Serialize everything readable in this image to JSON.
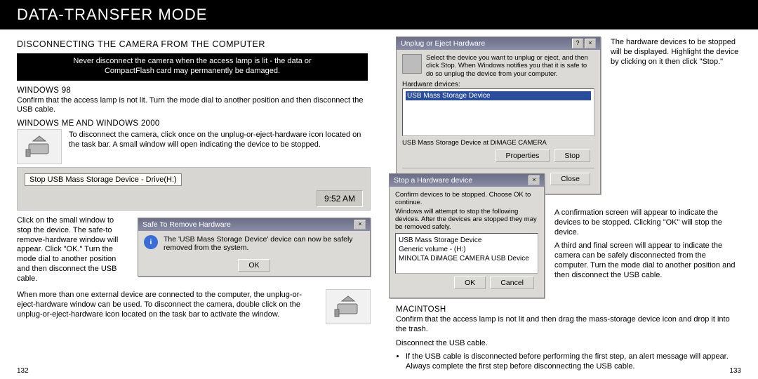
{
  "header": {
    "title": "DATA-TRANSFER MODE"
  },
  "left": {
    "subheading": "DISCONNECTING THE CAMERA FROM THE COMPUTER",
    "warning_line1": "Never disconnect the camera when the access lamp is lit - the data or",
    "warning_line2": "CompactFlash card may permanently be damaged.",
    "win98_heading": "WINDOWS 98",
    "win98_text": "Confirm that the access lamp is not lit. Turn the mode dial to another position and then disconnect the USB cable.",
    "winme_heading": "WINDOWS ME AND WINDOWS 2000",
    "winme_text": "To disconnect the camera, click once on the unplug-or-eject-hardware icon located on the task bar. A small window will open indicating the device to be stopped.",
    "taskbar_tooltip": "Stop USB Mass Storage Device - Drive(H:)",
    "taskbar_clock": "9:52 AM",
    "side_note": "Click on the small window to stop the device. The safe-to remove-hardware window will appear. Click \"OK.\" Turn the mode dial to another position and then disconnect the USB cable.",
    "safe_remove_title": "Safe To Remove Hardware",
    "safe_remove_body": "The 'USB Mass Storage Device' device can now be safely removed from the system.",
    "ok_label": "OK",
    "multi_device_text": "When more than one external device are connected to the computer, the unplug-or-eject-hardware window can be used. To disconnect the camera, double click on the unplug-or-eject-hardware icon located on the task bar to activate the window.",
    "page_num": "132"
  },
  "right": {
    "unplug_title": "Unplug or Eject Hardware",
    "unplug_instr": "Select the device you want to unplug or eject, and then click Stop. When Windows notifies you that it is safe to do so unplug the device from your computer.",
    "hw_label": "Hardware devices:",
    "hw_item": "USB Mass Storage Device",
    "device_line": "USB Mass Storage Device at DiMAGE CAMERA",
    "btn_properties": "Properties",
    "btn_stop": "Stop",
    "btn_close": "Close",
    "hw_caption": "The hardware devices to be stopped will be displayed. Highlight the device by clicking on it then click \"Stop.\"",
    "stop_title": "Stop a Hardware device",
    "stop_line1": "Confirm devices to be stopped. Choose OK to continue.",
    "stop_line2": "Windows will attempt to stop the following devices. After the devices are stopped they may be removed safely.",
    "stop_item1": "USB Mass Storage Device",
    "stop_item2": "Generic volume - (H:)",
    "stop_item3": "MINOLTA DiMAGE CAMERA USB Device",
    "btn_ok": "OK",
    "btn_cancel": "Cancel",
    "confirm_text": "A confirmation screen will appear to indicate the devices to be stopped. Clicking \"OK\" will stop the device.",
    "third_text": "A third and final screen will appear to indicate the camera can be safely disconnected from the computer. Turn the mode dial to another position and then disconnect the USB cable.",
    "mac_heading": "MACINTOSH",
    "mac_text": "Confirm that the access lamp is not lit and then drag the mass-storage device icon and drop it into the trash.",
    "mac_disc": "Disconnect the USB cable.",
    "mac_bullet": "If the USB cable is disconnected before performing the first step, an alert message will appear. Always complete the first step before disconnecting the USB cable.",
    "page_num": "133"
  }
}
